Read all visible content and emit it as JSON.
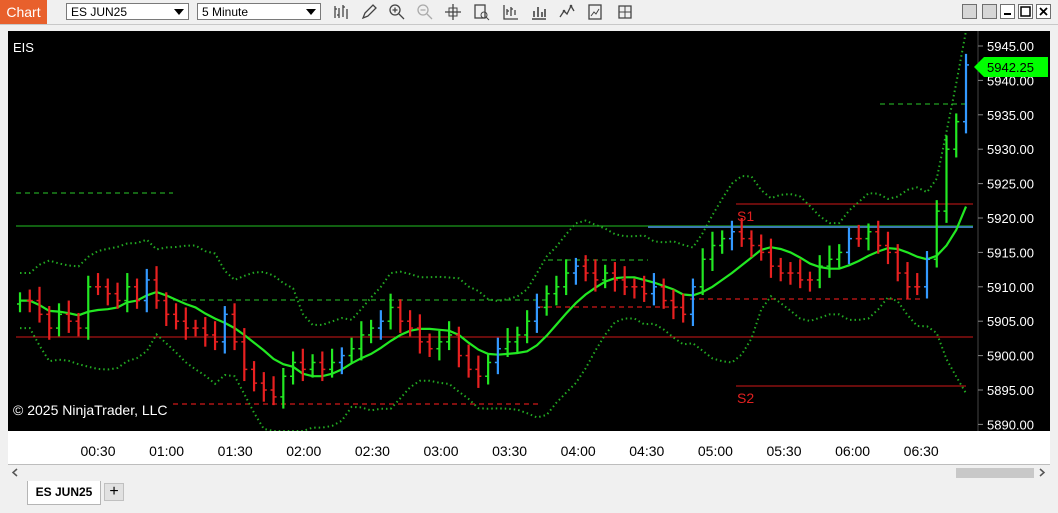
{
  "toolbar": {
    "chart_label": "Chart",
    "instrument": "ES JUN25",
    "interval": "5 Minute",
    "icons": [
      "bar-type-icon",
      "draw-tools-icon",
      "zoom-in-icon",
      "zoom-out-icon",
      "crosshair-icon",
      "data-box-icon",
      "indicators-icon",
      "strategies-icon",
      "chart-trader-icon",
      "properties-icon",
      "chart-style-icon"
    ]
  },
  "window": {
    "buttons": [
      "minimize",
      "restore",
      "maximize",
      "close"
    ]
  },
  "chart": {
    "instrument_label": "EIS",
    "copyright": "© 2025 NinjaTrader, LLC",
    "last_price": "5942.25",
    "y_ticks": [
      "5945.00",
      "5940.00",
      "5935.00",
      "5930.00",
      "5925.00",
      "5920.00",
      "5915.00",
      "5910.00",
      "5905.00",
      "5900.00",
      "5895.00",
      "5890.00"
    ],
    "x_ticks": [
      "00:30",
      "01:00",
      "01:30",
      "02:00",
      "02:30",
      "03:00",
      "03:30",
      "04:00",
      "04:30",
      "05:00",
      "05:30",
      "06:00",
      "06:30"
    ],
    "level_labels": {
      "s1": "S1",
      "s2": "S2"
    },
    "colors": {
      "up": "#22e822",
      "down": "#e82020",
      "neutral_up": "#3399ff",
      "ma": "#22e822",
      "bands": "#22aa22",
      "pivot": "#d01818",
      "price_tag": "#00ff00"
    }
  },
  "chart_data": {
    "type": "candlestick",
    "y_range": [
      5888,
      5948
    ],
    "ohlc_close_series": [
      5908,
      5908,
      5906,
      5904,
      5906,
      5905,
      5904,
      5910,
      5910,
      5909,
      5908,
      5910,
      5908,
      5911,
      5908,
      5906,
      5905,
      5904,
      5904,
      5903,
      5902,
      5906,
      5902,
      5898,
      5896,
      5895,
      5894,
      5897,
      5899,
      5898,
      5899,
      5898,
      5899,
      5900,
      5901,
      5903,
      5904,
      5905,
      5907,
      5905,
      5904,
      5902,
      5901,
      5902,
      5903,
      5900,
      5898,
      5897,
      5899,
      5901,
      5902,
      5903,
      5905,
      5907,
      5909,
      5910,
      5912,
      5913,
      5912,
      5911,
      5912,
      5911,
      5910,
      5910,
      5909,
      5910,
      5908,
      5907,
      5906,
      5910,
      5914,
      5916,
      5917,
      5918,
      5917,
      5916,
      5915,
      5913,
      5912,
      5912,
      5911,
      5911,
      5913,
      5914,
      5915,
      5917,
      5917,
      5918,
      5916,
      5915,
      5912,
      5910,
      5910,
      5914,
      5921,
      5930,
      5934,
      5942.25
    ]
  }
}
